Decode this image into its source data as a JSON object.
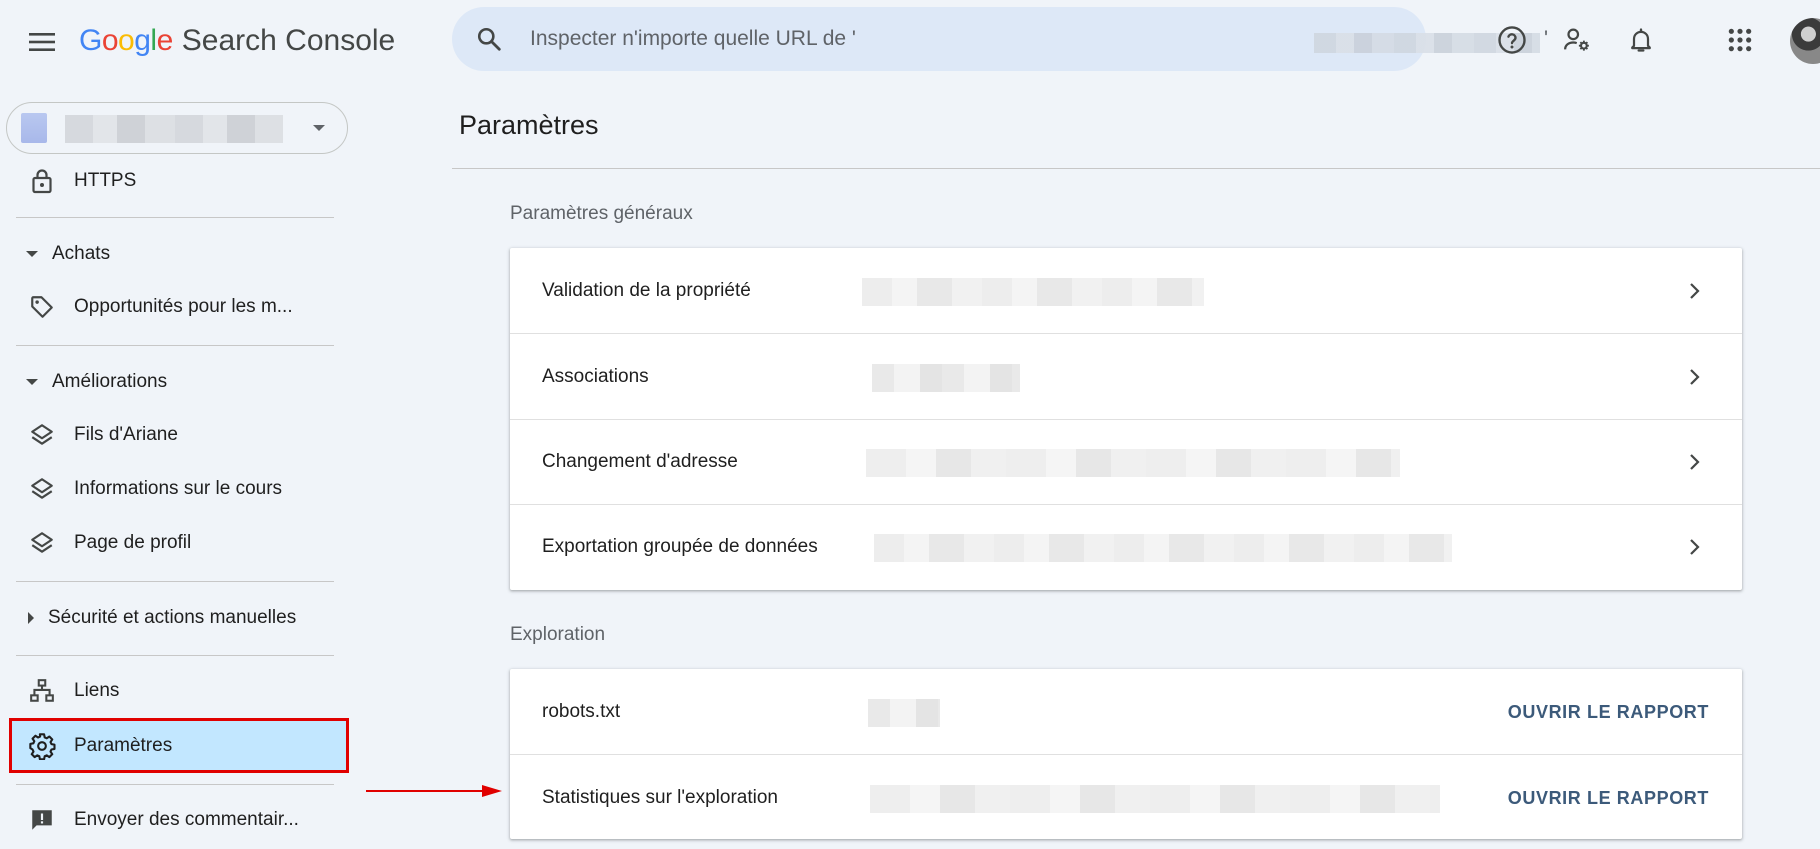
{
  "header": {
    "logo_google": [
      "G",
      "o",
      "o",
      "g",
      "l",
      "e"
    ],
    "logo_colors": [
      "#4285F4",
      "#EA4335",
      "#FBBC05",
      "#4285F4",
      "#34A853",
      "#EA4335"
    ],
    "product": "Search Console",
    "search_placeholder": "Inspecter n'importe quelle URL de '",
    "search_quote_end": "'",
    "icons": [
      "menu-icon",
      "search-icon",
      "help-icon",
      "manage-users-icon",
      "notifications-icon",
      "apps-grid-icon",
      "avatar"
    ]
  },
  "sidebar": {
    "top_item": {
      "label": "HTTPS",
      "icon": "lock-icon"
    },
    "sections": [
      {
        "title": "Achats",
        "expanded": true,
        "items": [
          {
            "label": "Opportunités pour les m...",
            "icon": "tag-icon"
          }
        ]
      },
      {
        "title": "Améliorations",
        "expanded": true,
        "items": [
          {
            "label": "Fils d'Ariane",
            "icon": "layers-icon"
          },
          {
            "label": "Informations sur le cours",
            "icon": "layers-icon"
          },
          {
            "label": "Page de profil",
            "icon": "layers-icon"
          }
        ]
      },
      {
        "title": "Sécurité et actions manuelles",
        "expanded": false,
        "items": []
      }
    ],
    "links": {
      "label": "Liens",
      "icon": "sitemap-icon"
    },
    "settings": {
      "label": "Paramètres",
      "icon": "gear-icon",
      "active": true
    },
    "feedback": {
      "label": "Envoyer des commentair...",
      "icon": "feedback-icon"
    }
  },
  "main": {
    "title": "Paramètres",
    "general": {
      "heading": "Paramètres généraux",
      "rows": [
        {
          "label": "Validation de la propriété"
        },
        {
          "label": "Associations"
        },
        {
          "label": "Changement d'adresse"
        },
        {
          "label": "Exportation groupée de données"
        }
      ]
    },
    "crawl": {
      "heading": "Exploration",
      "rows": [
        {
          "label": "robots.txt",
          "action": "OUVRIR LE RAPPORT"
        },
        {
          "label": "Statistiques sur l'exploration",
          "action": "OUVRIR LE RAPPORT"
        }
      ]
    }
  },
  "colors": {
    "background": "#f0f4f9",
    "search_bg": "#dde8f7",
    "active_nav": "#c2e7ff",
    "highlight": "#e00000",
    "action_text": "#3c5a7a"
  }
}
